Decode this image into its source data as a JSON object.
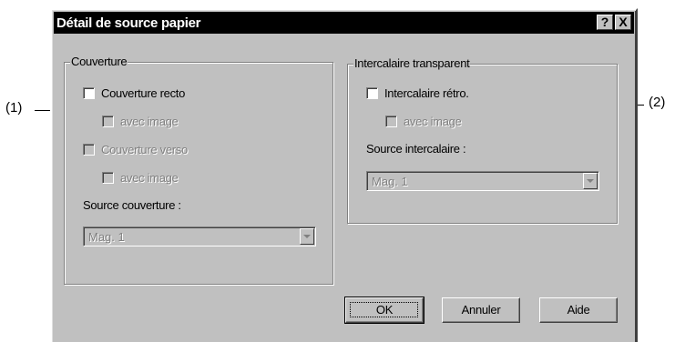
{
  "callouts": {
    "left": "(1)",
    "right": "(2)"
  },
  "dialog": {
    "title": "Détail de source papier",
    "help_button": "?",
    "close_button": "X"
  },
  "cover_group": {
    "title": "Couverture",
    "front_cover": {
      "label": "Couverture recto",
      "checked": false,
      "enabled": true
    },
    "front_with_image": {
      "label": "avec image",
      "checked": false,
      "enabled": false
    },
    "back_cover": {
      "label": "Couverture verso",
      "checked": false,
      "enabled": false
    },
    "back_with_image": {
      "label": "avec image",
      "checked": false,
      "enabled": false
    },
    "source_label": "Source couverture :",
    "source_value": "Mag. 1"
  },
  "interleaf_group": {
    "title": "Intercalaire transparent",
    "interleaf": {
      "label": "Intercalaire rétro.",
      "checked": false,
      "enabled": true
    },
    "with_image": {
      "label": "avec image",
      "checked": false,
      "enabled": false
    },
    "source_label": "Source intercalaire :",
    "source_value": "Mag. 1"
  },
  "buttons": {
    "ok": "OK",
    "cancel": "Annuler",
    "help": "Aide"
  }
}
